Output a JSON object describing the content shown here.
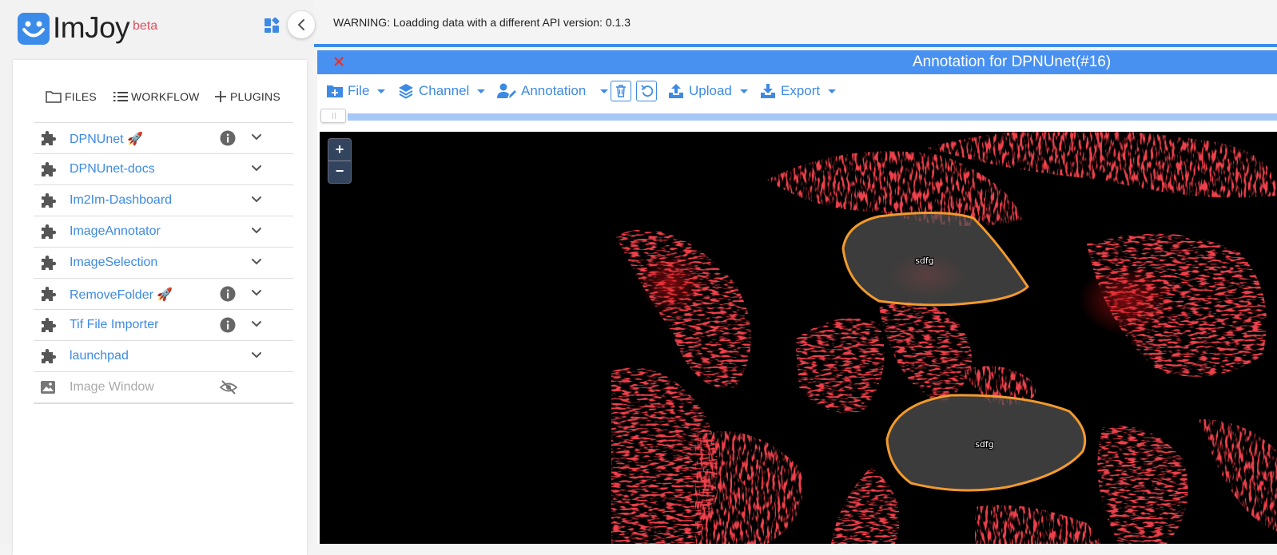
{
  "app": {
    "name": "ImJoy",
    "badge": "beta",
    "logo_icon": "smiley-logo-icon"
  },
  "tabs": [
    {
      "label": "FILES",
      "icon": "folder-icon"
    },
    {
      "label": "WORKFLOW",
      "icon": "list-icon"
    },
    {
      "label": "PLUGINS",
      "icon": "plus-icon"
    }
  ],
  "plugins": [
    {
      "name": "DPNUnet 🚀",
      "info": true,
      "expand": true
    },
    {
      "name": "DPNUnet-docs",
      "info": false,
      "expand": true
    },
    {
      "name": "Im2Im-Dashboard",
      "info": false,
      "expand": true
    },
    {
      "name": "ImageAnnotator",
      "info": false,
      "expand": true
    },
    {
      "name": "ImageSelection",
      "info": false,
      "expand": true
    },
    {
      "name": "RemoveFolder 🚀",
      "info": true,
      "expand": true
    },
    {
      "name": "Tif File Importer",
      "info": true,
      "expand": true
    },
    {
      "name": "launchpad",
      "info": false,
      "expand": true
    },
    {
      "name": "Image Window",
      "info": false,
      "expand": false,
      "disabled": true
    }
  ],
  "warning": "WARNING: Loadding data with a different API version: 0.1.3",
  "window": {
    "title": "Annotation for DPNUnet(#16)",
    "toolbar": {
      "file": "File",
      "channel": "Channel",
      "annotation": "Annotation",
      "upload": "Upload",
      "export": "Export"
    },
    "zoom_in": "+",
    "zoom_out": "−",
    "annotations": [
      {
        "label": "sdfg"
      },
      {
        "label": "sdfg"
      }
    ]
  },
  "colors": {
    "accent": "#3d8ae4",
    "title_bar": "#4991f0",
    "annotation_stroke": "#f29a2e",
    "cell_red": "#d8151a"
  }
}
